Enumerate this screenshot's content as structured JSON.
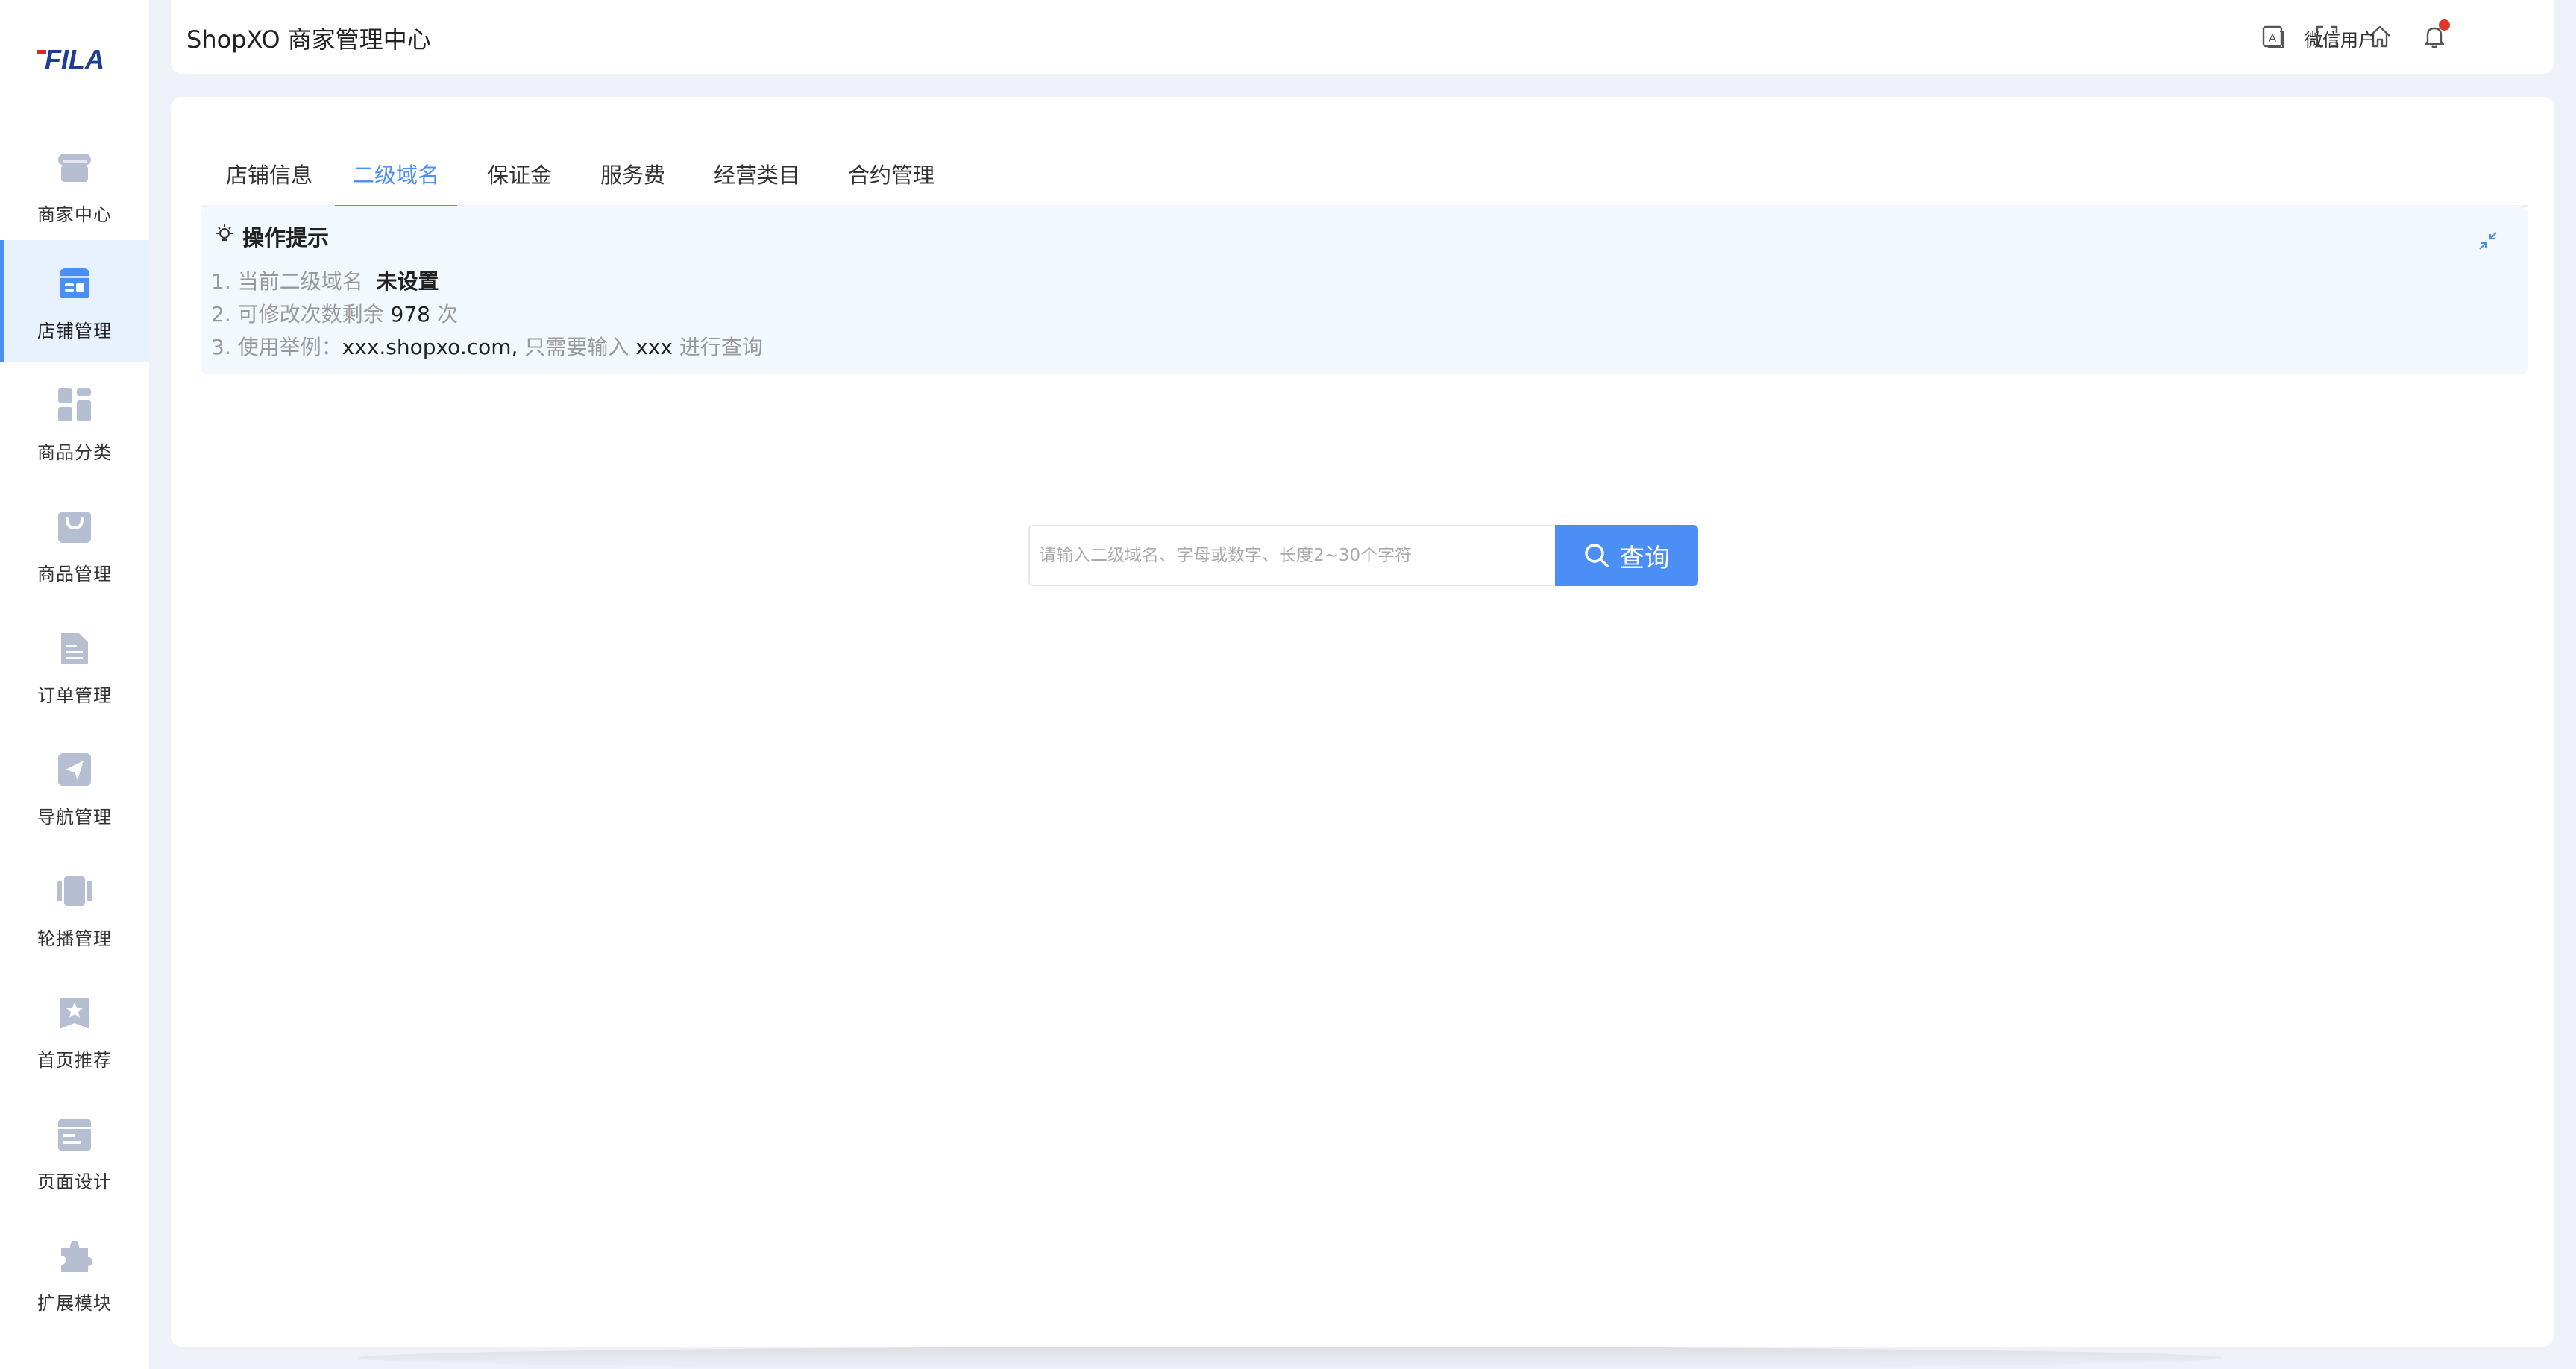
{
  "app": {
    "title": "ShopXO 商家管理中心",
    "brand": "FILA"
  },
  "sidebar": {
    "items": [
      {
        "label": "商家中心",
        "icon": "store-icon"
      },
      {
        "label": "店铺管理",
        "icon": "shop-card-icon",
        "active": true
      },
      {
        "label": "商品分类",
        "icon": "grid-icon"
      },
      {
        "label": "商品管理",
        "icon": "shopping-bag-icon"
      },
      {
        "label": "订单管理",
        "icon": "document-icon"
      },
      {
        "label": "导航管理",
        "icon": "send-icon"
      },
      {
        "label": "轮播管理",
        "icon": "carousel-icon"
      },
      {
        "label": "首页推荐",
        "icon": "star-bookmark-icon"
      },
      {
        "label": "页面设计",
        "icon": "layout-icon"
      },
      {
        "label": "扩展模块",
        "icon": "puzzle-icon"
      }
    ]
  },
  "header": {
    "user": "微信用户",
    "icons": [
      "translate-icon",
      "fullscreen-icon",
      "home-icon",
      "bell-icon"
    ]
  },
  "tabs": [
    {
      "label": "店铺信息"
    },
    {
      "label": "二级域名",
      "active": true
    },
    {
      "label": "保证金"
    },
    {
      "label": "服务费"
    },
    {
      "label": "经营类目"
    },
    {
      "label": "合约管理"
    }
  ],
  "tips": {
    "title": "操作提示",
    "line1_prefix": "1. 当前二级域名",
    "line1_value": "未设置",
    "line2_prefix": "2. 可修改次数剩余",
    "line2_value": "978",
    "line2_suffix": "次",
    "line3_prefix": "3. 使用举例：",
    "line3_example": "xxx.shopxo.com,",
    "line3_mid": "只需要输入",
    "line3_value": "xxx",
    "line3_suffix": "进行查询"
  },
  "search": {
    "placeholder": "请输入二级域名、字母或数字、长度2~30个字符",
    "button_label": "查询"
  },
  "colors": {
    "accent": "#4b8ef5",
    "tips_bg": "#f1f8fe",
    "notify": "#e0362b",
    "nav_icon": "#b6bfd1"
  }
}
